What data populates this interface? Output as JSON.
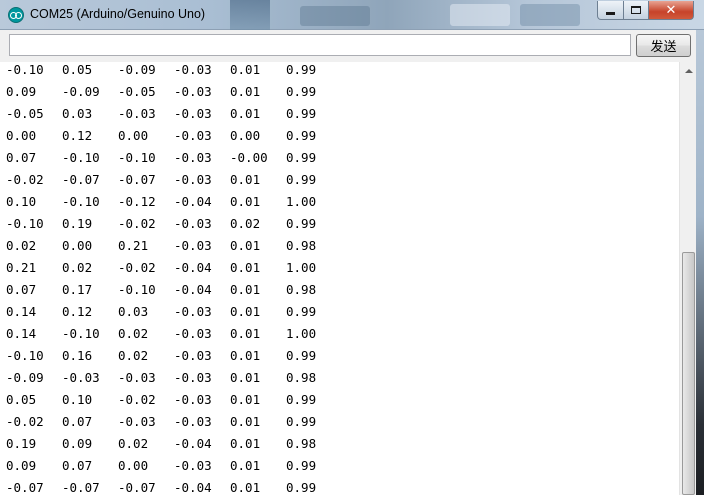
{
  "window": {
    "title": "COM25 (Arduino/Genuino Uno)",
    "app_icon": "arduino-icon",
    "minimize_icon": "minimize-icon",
    "maximize_icon": "maximize-icon",
    "close_icon": "close-icon",
    "close_glyph": "✕"
  },
  "input": {
    "value": "",
    "send_label": "发送"
  },
  "serial_output": {
    "rows": [
      [
        "-0.10",
        "0.05",
        "-0.09",
        "-0.03",
        "0.01",
        "0.99"
      ],
      [
        "0.09",
        "-0.09",
        "-0.05",
        "-0.03",
        "0.01",
        "0.99"
      ],
      [
        "-0.05",
        "0.03",
        "-0.03",
        "-0.03",
        "0.01",
        "0.99"
      ],
      [
        "0.00",
        "0.12",
        "0.00",
        "-0.03",
        "0.00",
        "0.99"
      ],
      [
        "0.07",
        "-0.10",
        "-0.10",
        "-0.03",
        "-0.00",
        "0.99"
      ],
      [
        "-0.02",
        "-0.07",
        "-0.07",
        "-0.03",
        "0.01",
        "0.99"
      ],
      [
        "0.10",
        "-0.10",
        "-0.12",
        "-0.04",
        "0.01",
        "1.00"
      ],
      [
        "-0.10",
        "0.19",
        "-0.02",
        "-0.03",
        "0.02",
        "0.99"
      ],
      [
        "0.02",
        "0.00",
        "0.21",
        "-0.03",
        "0.01",
        "0.98"
      ],
      [
        "0.21",
        "0.02",
        "-0.02",
        "-0.04",
        "0.01",
        "1.00"
      ],
      [
        "0.07",
        "0.17",
        "-0.10",
        "-0.04",
        "0.01",
        "0.98"
      ],
      [
        "0.14",
        "0.12",
        "0.03",
        "-0.03",
        "0.01",
        "0.99"
      ],
      [
        "0.14",
        "-0.10",
        "0.02",
        "-0.03",
        "0.01",
        "1.00"
      ],
      [
        "-0.10",
        "0.16",
        "0.02",
        "-0.03",
        "0.01",
        "0.99"
      ],
      [
        "-0.09",
        "-0.03",
        "-0.03",
        "-0.03",
        "0.01",
        "0.98"
      ],
      [
        "0.05",
        "0.10",
        "-0.02",
        "-0.03",
        "0.01",
        "0.99"
      ],
      [
        "-0.02",
        "0.07",
        "-0.03",
        "-0.03",
        "0.01",
        "0.99"
      ],
      [
        "0.19",
        "0.09",
        "0.02",
        "-0.04",
        "0.01",
        "0.98"
      ],
      [
        "0.09",
        "0.07",
        "0.00",
        "-0.03",
        "0.01",
        "0.99"
      ],
      [
        "-0.07",
        "-0.07",
        "-0.07",
        "-0.04",
        "0.01",
        "0.99"
      ]
    ]
  },
  "scrollbar": {
    "up_icon": "scroll-up-arrow-icon"
  },
  "colors": {
    "arduino_teal": "#00979d",
    "close_red": "#c7432a"
  }
}
